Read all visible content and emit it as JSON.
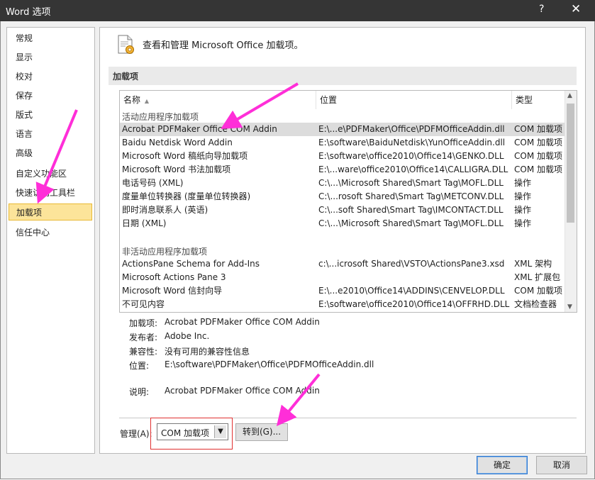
{
  "window": {
    "title": "Word 选项",
    "help_glyph": "?",
    "close_glyph": "✕"
  },
  "sidebar": {
    "items": [
      {
        "label": "常规"
      },
      {
        "label": "显示"
      },
      {
        "label": "校对"
      },
      {
        "label": "保存"
      },
      {
        "label": "版式"
      },
      {
        "label": "语言"
      },
      {
        "label": "高级"
      },
      {
        "label": "自定义功能区"
      },
      {
        "label": "快速访问工具栏"
      },
      {
        "label": "加载项"
      },
      {
        "label": "信任中心"
      }
    ],
    "selected_index": 9
  },
  "header": {
    "text": "查看和管理 Microsoft Office 加载项。",
    "icon": "addins-gear-icon"
  },
  "section": {
    "title": "加载项"
  },
  "table": {
    "columns": [
      {
        "label": "名称",
        "sort": "▲"
      },
      {
        "label": "位置"
      },
      {
        "label": "类型"
      }
    ],
    "active_group_label": "活动应用程序加载项",
    "active_rows": [
      {
        "name": "Acrobat PDFMaker Office COM Addin",
        "location": "E:\\...e\\PDFMaker\\Office\\PDFMOfficeAddin.dll",
        "type": "COM 加载项"
      },
      {
        "name": "Baidu Netdisk Word Addin",
        "location": "E:\\software\\BaiduNetdisk\\YunOfficeAddin.dll",
        "type": "COM 加载项"
      },
      {
        "name": "Microsoft Word 稿纸向导加载项",
        "location": "E:\\software\\office2010\\Office14\\GENKO.DLL",
        "type": "COM 加载项"
      },
      {
        "name": "Microsoft Word 书法加载项",
        "location": "E:\\...ware\\office2010\\Office14\\CALLIGRA.DLL",
        "type": "COM 加载项"
      },
      {
        "name": "电话号码 (XML)",
        "location": "C:\\...\\Microsoft Shared\\Smart Tag\\MOFL.DLL",
        "type": "操作"
      },
      {
        "name": "度量单位转换器 (度量单位转换器)",
        "location": "C:\\...rosoft Shared\\Smart Tag\\METCONV.DLL",
        "type": "操作"
      },
      {
        "name": "即时消息联系人 (英语)",
        "location": "C:\\...soft Shared\\Smart Tag\\IMCONTACT.DLL",
        "type": "操作"
      },
      {
        "name": "日期 (XML)",
        "location": "C:\\...\\Microsoft Shared\\Smart Tag\\MOFL.DLL",
        "type": "操作"
      }
    ],
    "inactive_group_label": "非活动应用程序加载项",
    "inactive_rows": [
      {
        "name": "ActionsPane Schema for Add-Ins",
        "location": "c:\\...icrosoft Shared\\VSTO\\ActionsPane3.xsd",
        "type": "XML 架构"
      },
      {
        "name": "Microsoft Actions Pane 3",
        "location": "",
        "type": "XML 扩展包"
      },
      {
        "name": "Microsoft Word 信封向导",
        "location": "E:\\...e2010\\Office14\\ADDINS\\CENVELOP.DLL",
        "type": "COM 加载项"
      },
      {
        "name": "不可见内容",
        "location": "E:\\software\\office2010\\Office14\\OFFRHD.DLL",
        "type": "文档检查器"
      }
    ]
  },
  "details": {
    "addin_label": "加载项:",
    "addin_value": "Acrobat PDFMaker Office COM Addin",
    "publisher_label": "发布者:",
    "publisher_value": "Adobe Inc.",
    "compat_label": "兼容性:",
    "compat_value": "没有可用的兼容性信息",
    "location_label": "位置:",
    "location_value": "E:\\software\\PDFMaker\\Office\\PDFMOfficeAddin.dll",
    "desc_label": "说明:",
    "desc_value": "Acrobat PDFMaker Office COM Addin"
  },
  "manage": {
    "label": "管理(A):",
    "selected": "COM 加载项",
    "goto_label": "转到(G)..."
  },
  "footer": {
    "ok_label": "确定",
    "cancel_label": "取消"
  },
  "colors": {
    "arrow": "#ff2ed8",
    "highlight_box": "#e03030",
    "selected_item": "#fce49a"
  }
}
